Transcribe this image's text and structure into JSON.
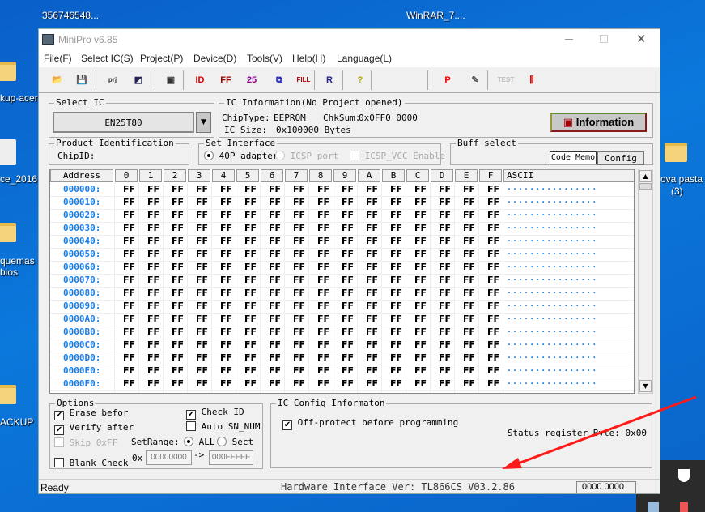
{
  "desktop": {
    "icons_top": [
      "356746548...",
      "WinRAR_7...."
    ],
    "icons_left": [
      "kup-acer",
      "ce_2016",
      "quemas",
      "bios",
      "ACKUP"
    ],
    "icons_right": [
      "ova pasta",
      "(3)"
    ]
  },
  "window": {
    "title": "MiniPro v6.85"
  },
  "menu": [
    "File(F)",
    "Select IC(S)",
    "Project(P)",
    "Device(D)",
    "Tools(V)",
    "Help(H)",
    "Language(L)"
  ],
  "toolbar": [
    {
      "icon": "open-folder-icon",
      "glyph": "📂"
    },
    {
      "icon": "save-icon",
      "glyph": "💾"
    },
    {
      "icon": "open-project-icon",
      "glyph": "prj"
    },
    {
      "icon": "save-project-icon",
      "glyph": "◩"
    },
    {
      "icon": "device-icon",
      "glyph": "▣"
    },
    {
      "icon": "read-id-icon",
      "glyph": "ID"
    },
    {
      "icon": "read-icon",
      "glyph": "FF"
    },
    {
      "icon": "verify-icon",
      "glyph": "25"
    },
    {
      "icon": "blank-check-icon",
      "glyph": "⧉"
    },
    {
      "icon": "fill-icon",
      "glyph": "FILL"
    },
    {
      "icon": "read-chip-icon",
      "glyph": "R"
    },
    {
      "icon": "help-icon",
      "glyph": "?"
    },
    {
      "icon": "program-icon",
      "glyph": "P"
    },
    {
      "icon": "edit-icon",
      "glyph": "✎"
    },
    {
      "icon": "test-icon",
      "glyph": "TEST"
    },
    {
      "icon": "pin-check-icon",
      "glyph": "⫼"
    }
  ],
  "select_ic": {
    "title": "Select IC",
    "value": "EN25T80"
  },
  "ic_info": {
    "title": "IC Information(No Project opened)",
    "chip_type_label": "ChipType:",
    "chip_type": "EEPROM",
    "chksum_label": "ChkSum:",
    "chksum": "0x0FF0 0000",
    "size_label": "IC Size:",
    "size": "0x100000 Bytes",
    "info_button": "Information"
  },
  "product_id": {
    "title": "Product Identification",
    "chipid_label": "ChipID:"
  },
  "interface": {
    "title": "Set Interface",
    "opt1": "40P adapter",
    "opt2": "ICSP port",
    "opt3": "ICSP_VCC Enable"
  },
  "buff": {
    "title": "Buff select",
    "code": "Code Memo",
    "config": "Config"
  },
  "hex": {
    "address_header": "Address",
    "columns": [
      "0",
      "1",
      "2",
      "3",
      "4",
      "5",
      "6",
      "7",
      "8",
      "9",
      "A",
      "B",
      "C",
      "D",
      "E",
      "F"
    ],
    "ascii_header": "ASCII",
    "addresses": [
      "000000:",
      "000010:",
      "000020:",
      "000030:",
      "000040:",
      "000050:",
      "000060:",
      "000070:",
      "000080:",
      "000090:",
      "0000A0:",
      "0000B0:",
      "0000C0:",
      "0000D0:",
      "0000E0:",
      "0000F0:"
    ],
    "byte_value": "FF",
    "ascii_row": "................"
  },
  "options": {
    "title": "Options",
    "erase": "Erase befor",
    "verify": "Verify after",
    "skip": "Skip 0xFF",
    "blank": "Blank Check",
    "check_id": "Check ID",
    "auto_sn": "Auto SN_NUM",
    "setrange": "SetRange:",
    "all": "ALL",
    "sect": "Sect",
    "ox": "0x",
    "from": "00000000",
    "arrow": "->",
    "to": "000FFFFF"
  },
  "ic_config": {
    "title": "IC Config Informaton",
    "off_protect": "Off-protect before programming",
    "status_reg": "Status register Byte: 0x00"
  },
  "status": {
    "ready": "Ready",
    "hw": "Hardware Interface Ver: TL866CS V03.2.86",
    "counter": "0000 0000"
  },
  "colors": {
    "address": "#1a7ee8",
    "annotation_arrow": "#ff1a1a"
  }
}
